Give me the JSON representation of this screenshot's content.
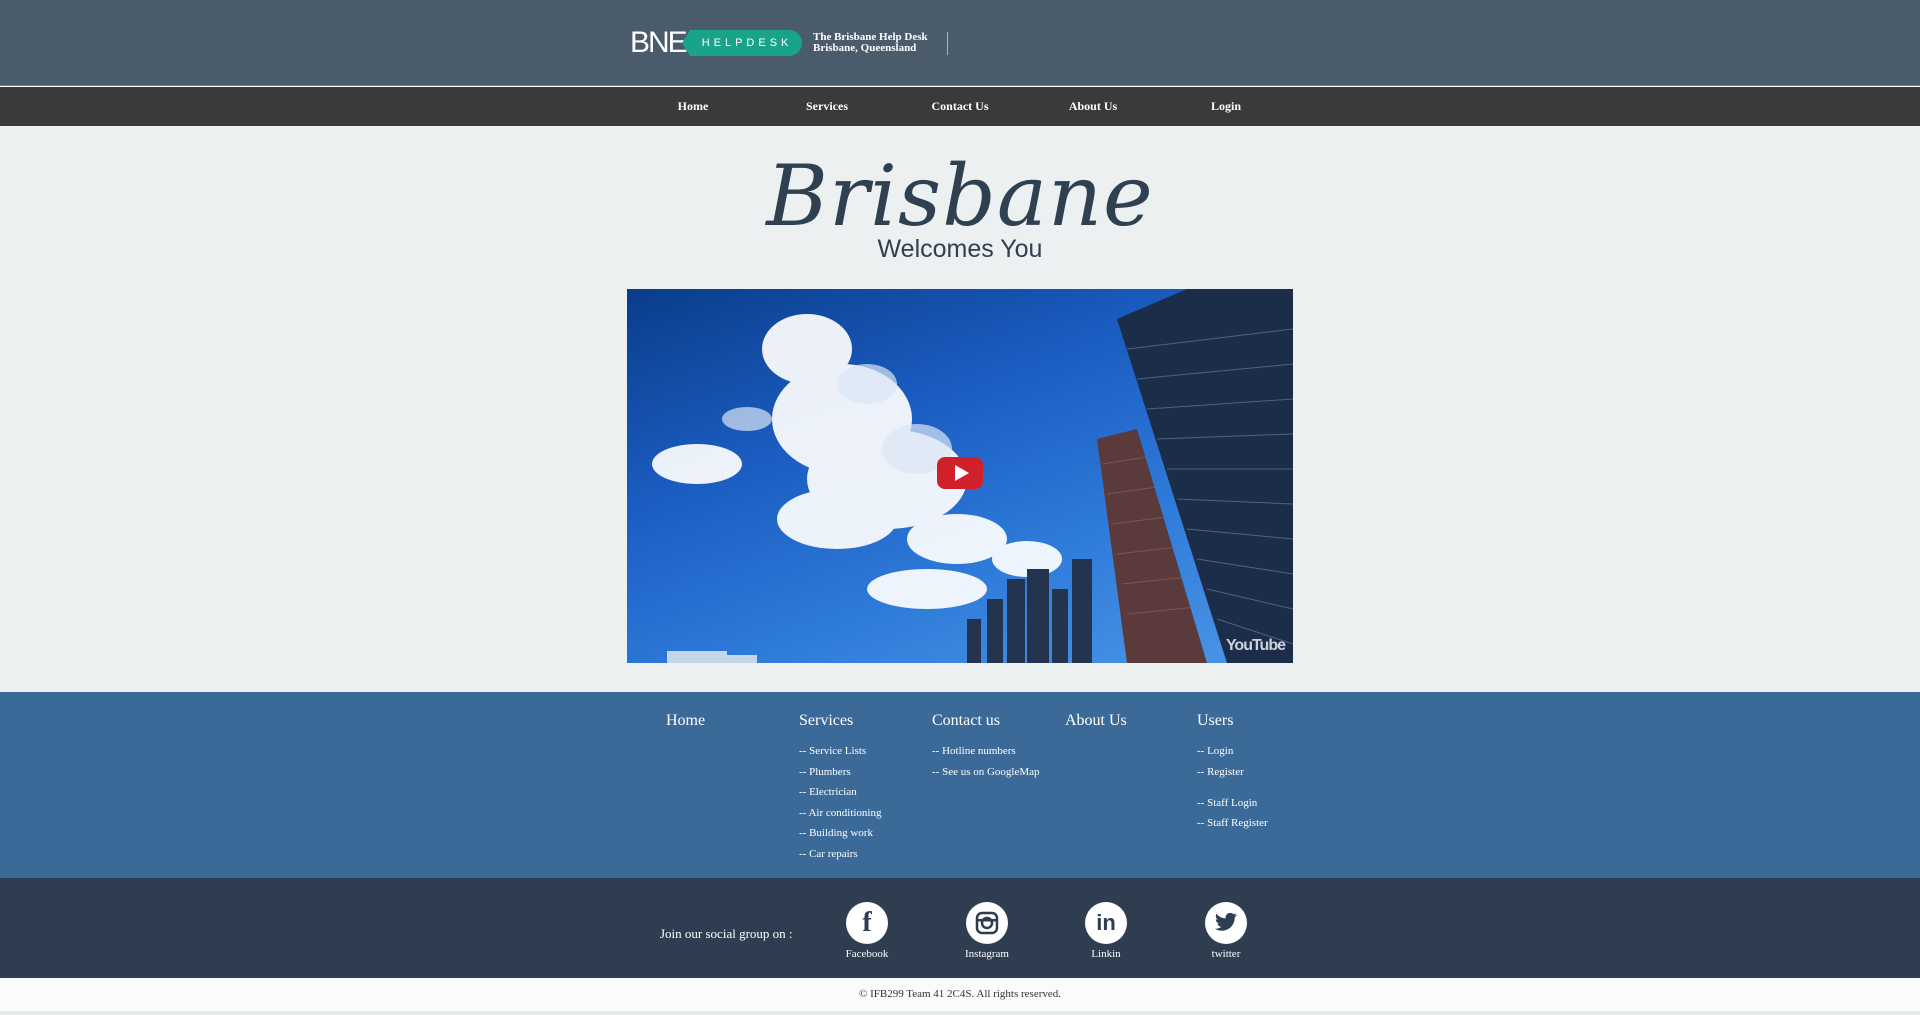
{
  "header": {
    "logo_main": "BNE",
    "logo_tag": "HELPDESK",
    "info_line1": "The Brisbane Help Desk",
    "info_line2": "Brisbane, Queensland"
  },
  "nav": {
    "items": [
      "Home",
      "Services",
      "Contact Us",
      "About Us",
      "Login"
    ]
  },
  "hero": {
    "title": "Brisbane",
    "subtitle": "Welcomes You",
    "video_badge": "YouTube"
  },
  "footer": {
    "columns": [
      {
        "heading": "Home",
        "links": []
      },
      {
        "heading": "Services",
        "links": [
          "-- Service Lists",
          "-- Plumbers",
          "-- Electrician",
          "-- Air conditioning",
          "-- Building work",
          "-- Car repairs"
        ]
      },
      {
        "heading": "Contact us",
        "links": [
          "-- Hotline numbers",
          "-- See us on GoogleMap"
        ]
      },
      {
        "heading": "About Us",
        "links": []
      },
      {
        "heading": "Users",
        "links": [
          "-- Login",
          "-- Register",
          "-- Staff Login",
          "-- Staff Register"
        ]
      }
    ]
  },
  "social": {
    "label": "Join our social group on :",
    "items": [
      {
        "name": "Facebook",
        "icon": "facebook-icon",
        "glyph": "f"
      },
      {
        "name": "Instagram",
        "icon": "instagram-icon",
        "glyph": "◎"
      },
      {
        "name": "Linkin",
        "icon": "linkedin-icon",
        "glyph": "in"
      },
      {
        "name": "twitter",
        "icon": "twitter-icon",
        "glyph": "🐦"
      }
    ]
  },
  "copyright": "© IFB299 Team 41 2C4S. All rights reserved.",
  "colors": {
    "header": "#4a5b6c",
    "nav": "#3a3a3a",
    "main_bg": "#ecf0f1",
    "footer_links": "#3b6a99",
    "social_bg": "#2e3e50",
    "accent": "#19a48a",
    "play": "#d0202a"
  }
}
